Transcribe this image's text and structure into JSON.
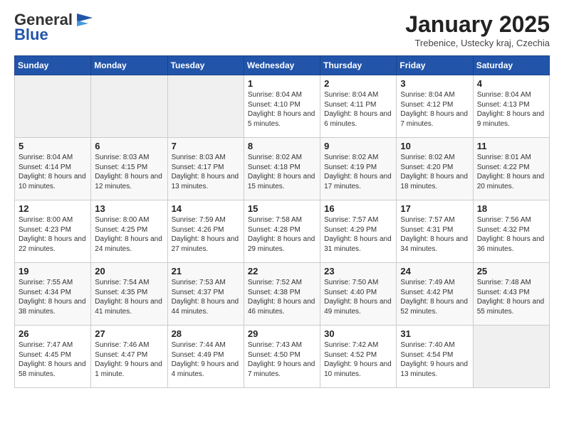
{
  "header": {
    "logo_general": "General",
    "logo_blue": "Blue",
    "month": "January 2025",
    "location": "Trebenice, Ustecky kraj, Czechia"
  },
  "days_of_week": [
    "Sunday",
    "Monday",
    "Tuesday",
    "Wednesday",
    "Thursday",
    "Friday",
    "Saturday"
  ],
  "weeks": [
    [
      {
        "day": "",
        "empty": true
      },
      {
        "day": "",
        "empty": true
      },
      {
        "day": "",
        "empty": true
      },
      {
        "day": "1",
        "sunrise": "8:04 AM",
        "sunset": "4:10 PM",
        "daylight": "8 hours and 5 minutes."
      },
      {
        "day": "2",
        "sunrise": "8:04 AM",
        "sunset": "4:11 PM",
        "daylight": "8 hours and 6 minutes."
      },
      {
        "day": "3",
        "sunrise": "8:04 AM",
        "sunset": "4:12 PM",
        "daylight": "8 hours and 7 minutes."
      },
      {
        "day": "4",
        "sunrise": "8:04 AM",
        "sunset": "4:13 PM",
        "daylight": "8 hours and 9 minutes."
      }
    ],
    [
      {
        "day": "5",
        "sunrise": "8:04 AM",
        "sunset": "4:14 PM",
        "daylight": "8 hours and 10 minutes."
      },
      {
        "day": "6",
        "sunrise": "8:03 AM",
        "sunset": "4:15 PM",
        "daylight": "8 hours and 12 minutes."
      },
      {
        "day": "7",
        "sunrise": "8:03 AM",
        "sunset": "4:17 PM",
        "daylight": "8 hours and 13 minutes."
      },
      {
        "day": "8",
        "sunrise": "8:02 AM",
        "sunset": "4:18 PM",
        "daylight": "8 hours and 15 minutes."
      },
      {
        "day": "9",
        "sunrise": "8:02 AM",
        "sunset": "4:19 PM",
        "daylight": "8 hours and 17 minutes."
      },
      {
        "day": "10",
        "sunrise": "8:02 AM",
        "sunset": "4:20 PM",
        "daylight": "8 hours and 18 minutes."
      },
      {
        "day": "11",
        "sunrise": "8:01 AM",
        "sunset": "4:22 PM",
        "daylight": "8 hours and 20 minutes."
      }
    ],
    [
      {
        "day": "12",
        "sunrise": "8:00 AM",
        "sunset": "4:23 PM",
        "daylight": "8 hours and 22 minutes."
      },
      {
        "day": "13",
        "sunrise": "8:00 AM",
        "sunset": "4:25 PM",
        "daylight": "8 hours and 24 minutes."
      },
      {
        "day": "14",
        "sunrise": "7:59 AM",
        "sunset": "4:26 PM",
        "daylight": "8 hours and 27 minutes."
      },
      {
        "day": "15",
        "sunrise": "7:58 AM",
        "sunset": "4:28 PM",
        "daylight": "8 hours and 29 minutes."
      },
      {
        "day": "16",
        "sunrise": "7:57 AM",
        "sunset": "4:29 PM",
        "daylight": "8 hours and 31 minutes."
      },
      {
        "day": "17",
        "sunrise": "7:57 AM",
        "sunset": "4:31 PM",
        "daylight": "8 hours and 34 minutes."
      },
      {
        "day": "18",
        "sunrise": "7:56 AM",
        "sunset": "4:32 PM",
        "daylight": "8 hours and 36 minutes."
      }
    ],
    [
      {
        "day": "19",
        "sunrise": "7:55 AM",
        "sunset": "4:34 PM",
        "daylight": "8 hours and 38 minutes."
      },
      {
        "day": "20",
        "sunrise": "7:54 AM",
        "sunset": "4:35 PM",
        "daylight": "8 hours and 41 minutes."
      },
      {
        "day": "21",
        "sunrise": "7:53 AM",
        "sunset": "4:37 PM",
        "daylight": "8 hours and 44 minutes."
      },
      {
        "day": "22",
        "sunrise": "7:52 AM",
        "sunset": "4:38 PM",
        "daylight": "8 hours and 46 minutes."
      },
      {
        "day": "23",
        "sunrise": "7:50 AM",
        "sunset": "4:40 PM",
        "daylight": "8 hours and 49 minutes."
      },
      {
        "day": "24",
        "sunrise": "7:49 AM",
        "sunset": "4:42 PM",
        "daylight": "8 hours and 52 minutes."
      },
      {
        "day": "25",
        "sunrise": "7:48 AM",
        "sunset": "4:43 PM",
        "daylight": "8 hours and 55 minutes."
      }
    ],
    [
      {
        "day": "26",
        "sunrise": "7:47 AM",
        "sunset": "4:45 PM",
        "daylight": "8 hours and 58 minutes."
      },
      {
        "day": "27",
        "sunrise": "7:46 AM",
        "sunset": "4:47 PM",
        "daylight": "9 hours and 1 minute."
      },
      {
        "day": "28",
        "sunrise": "7:44 AM",
        "sunset": "4:49 PM",
        "daylight": "9 hours and 4 minutes."
      },
      {
        "day": "29",
        "sunrise": "7:43 AM",
        "sunset": "4:50 PM",
        "daylight": "9 hours and 7 minutes."
      },
      {
        "day": "30",
        "sunrise": "7:42 AM",
        "sunset": "4:52 PM",
        "daylight": "9 hours and 10 minutes."
      },
      {
        "day": "31",
        "sunrise": "7:40 AM",
        "sunset": "4:54 PM",
        "daylight": "9 hours and 13 minutes."
      },
      {
        "day": "",
        "empty": true
      }
    ]
  ]
}
